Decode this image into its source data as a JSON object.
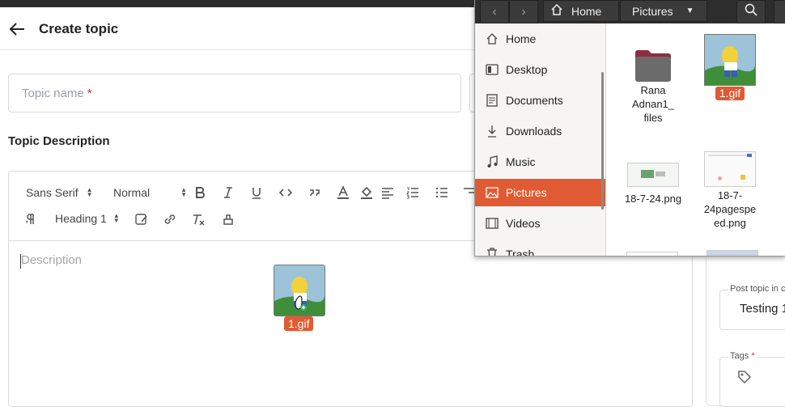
{
  "page": {
    "title": "Create topic",
    "topic_name_placeholder": "Topic name",
    "required_mark": "*",
    "description_heading": "Topic Description"
  },
  "editor": {
    "font_select": "Sans Serif",
    "size_select": "Normal",
    "heading_select": "Heading 1",
    "description_placeholder": "Description"
  },
  "drag": {
    "filename": "1.gif"
  },
  "sidebar": {
    "post_topic_label": "Post topic in c",
    "post_topic_value": "Testing 1",
    "tags_label": "Tags"
  },
  "file_dialog": {
    "path": [
      "Home",
      "Pictures"
    ],
    "places": [
      {
        "label": "Home",
        "icon": "home-icon"
      },
      {
        "label": "Desktop",
        "icon": "desktop-icon"
      },
      {
        "label": "Documents",
        "icon": "documents-icon"
      },
      {
        "label": "Downloads",
        "icon": "download-icon"
      },
      {
        "label": "Music",
        "icon": "music-icon"
      },
      {
        "label": "Pictures",
        "icon": "pictures-icon",
        "selected": true
      },
      {
        "label": "Videos",
        "icon": "videos-icon"
      },
      {
        "label": "Trash",
        "icon": "trash-icon"
      }
    ],
    "files": [
      {
        "name_lines": [
          "Rana",
          "Adnan1_",
          "files"
        ],
        "kind": "folder"
      },
      {
        "name_lines": [
          "1.gif"
        ],
        "kind": "gif",
        "selected": true
      },
      {
        "name_lines": [
          "18-7-24.png"
        ],
        "kind": "png"
      },
      {
        "name_lines": [
          "18-7-",
          "24pagespe",
          "ed.png"
        ],
        "kind": "png"
      }
    ]
  },
  "colors": {
    "accent": "#e05a33",
    "dialog_header": "#2d2d2d",
    "required": "#d93025"
  }
}
